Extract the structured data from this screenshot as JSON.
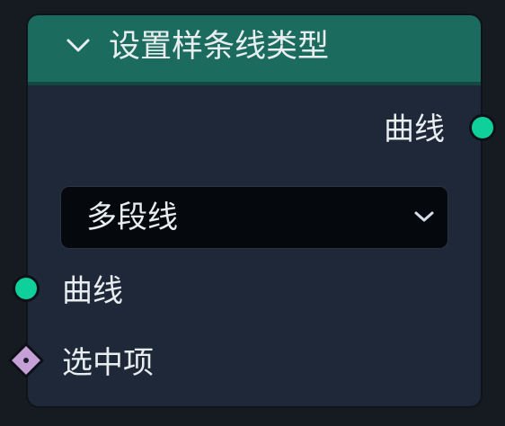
{
  "node": {
    "title": "设置样条线类型",
    "collapse_icon": "chevron-down-icon",
    "header_color": "#1b6b5f",
    "body_color": "#1e2839"
  },
  "outputs": [
    {
      "label": "曲线",
      "socket_color": "#0fcf9b",
      "socket_shape": "circle"
    }
  ],
  "dropdown": {
    "value": "多段线",
    "icon": "chevron-down-icon"
  },
  "inputs": [
    {
      "label": "曲线",
      "socket_color": "#0fcf9b",
      "socket_shape": "circle"
    },
    {
      "label": "选中项",
      "socket_color": "#c6a1d8",
      "socket_shape": "diamond"
    }
  ]
}
